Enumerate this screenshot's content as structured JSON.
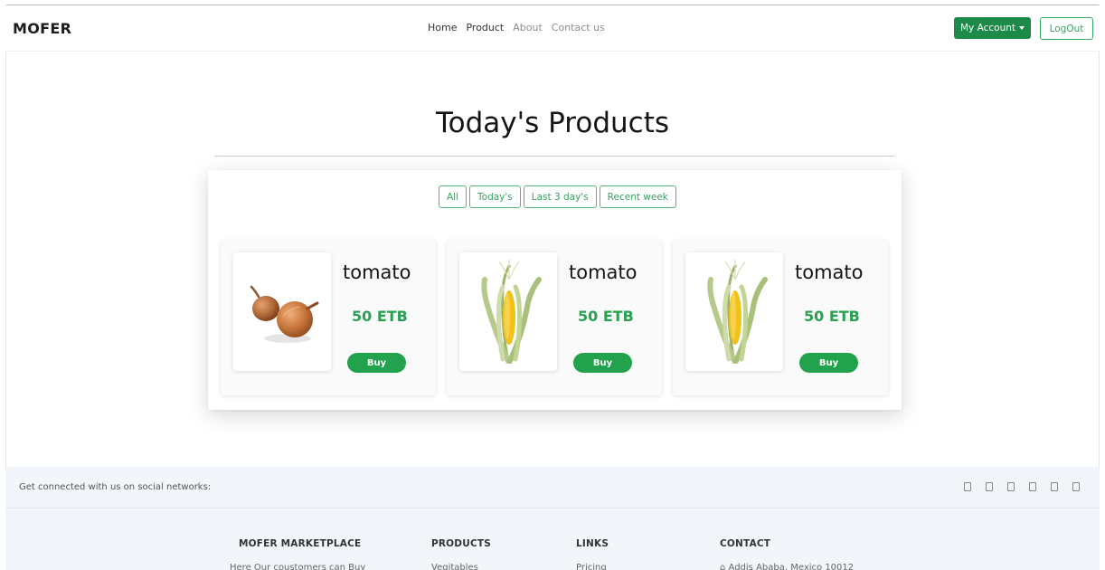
{
  "navbar": {
    "brand": "MOFER",
    "links": [
      "Home",
      "Product",
      "About",
      "Contact us"
    ],
    "account_label": "My Account",
    "logout_label": "LogOut"
  },
  "main": {
    "title": "Today's Products",
    "filters": [
      "All",
      "Today's",
      "Last 3 day's",
      "Recent week"
    ],
    "products": [
      {
        "name": "tomato",
        "price": "50 ETB",
        "buy_label": "Buy",
        "image": "onion-image"
      },
      {
        "name": "tomato",
        "price": "50 ETB",
        "buy_label": "Buy",
        "image": "corn-image"
      },
      {
        "name": "tomato",
        "price": "50 ETB",
        "buy_label": "Buy",
        "image": "corn-image"
      }
    ]
  },
  "social": {
    "text": "Get connected with us on social networks:",
    "icons": [
      "facebook-icon",
      "twitter-icon",
      "google-icon",
      "instagram-icon",
      "linkedin-icon",
      "github-icon"
    ]
  },
  "footer": {
    "columns": [
      {
        "heading": "MOFER MARKETPLACE",
        "line": "Here Our coustomers can Buy"
      },
      {
        "heading": "PRODUCTS",
        "line": "Vegitables"
      },
      {
        "heading": "LINKS",
        "line": "Pricing"
      },
      {
        "heading": "CONTACT",
        "line": "Addis Ababa, Mexico 10012"
      }
    ]
  },
  "colors": {
    "primary_green": "#1e8a4a",
    "price_green": "#2aa152",
    "footer_bg": "#f2f5f9"
  }
}
